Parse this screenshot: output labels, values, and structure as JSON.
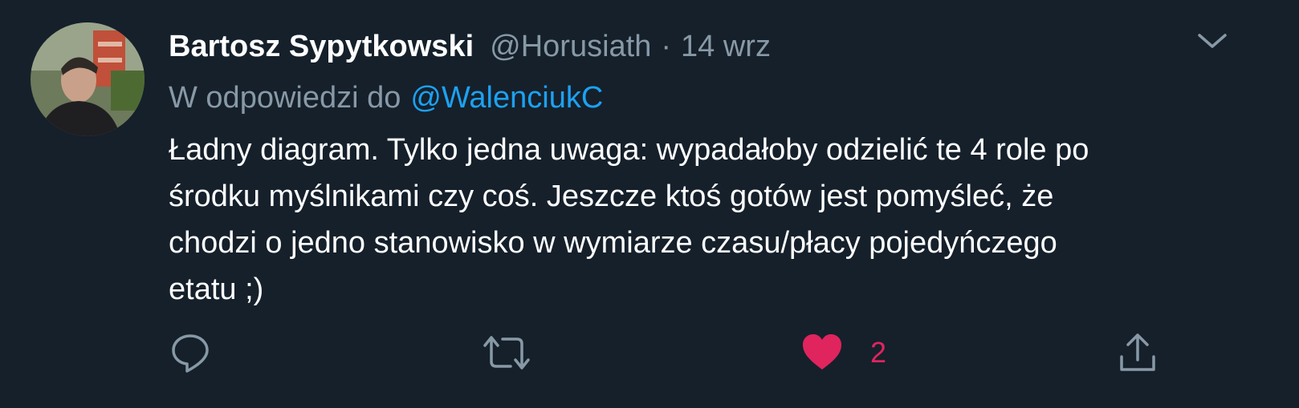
{
  "tweet": {
    "author_name": "Bartosz Sypytkowski",
    "author_handle": "@Horusiath",
    "separator": "·",
    "date": "14 wrz",
    "reply_prefix": "W odpowiedzi do",
    "reply_mention": "@WalenciukC",
    "text": "Ładny diagram. Tylko jedna uwaga: wypadałoby odzielić te 4 role po\nśrodku myślnikami czy coś. Jeszcze ktoś gotów jest pomyśleć, że\nchodzi o jedno stanowisko w wymiarze czasu/płacy pojedyńczego\netatu ;)"
  },
  "actions": {
    "reply_icon": "reply-icon",
    "retweet_icon": "retweet-icon",
    "like_icon": "heart-icon",
    "like_count": "2",
    "share_icon": "share-icon"
  },
  "colors": {
    "background": "#15202b",
    "text_primary": "#ffffff",
    "text_secondary": "#8899a6",
    "link": "#1da1f2",
    "like": "#e0245e"
  }
}
